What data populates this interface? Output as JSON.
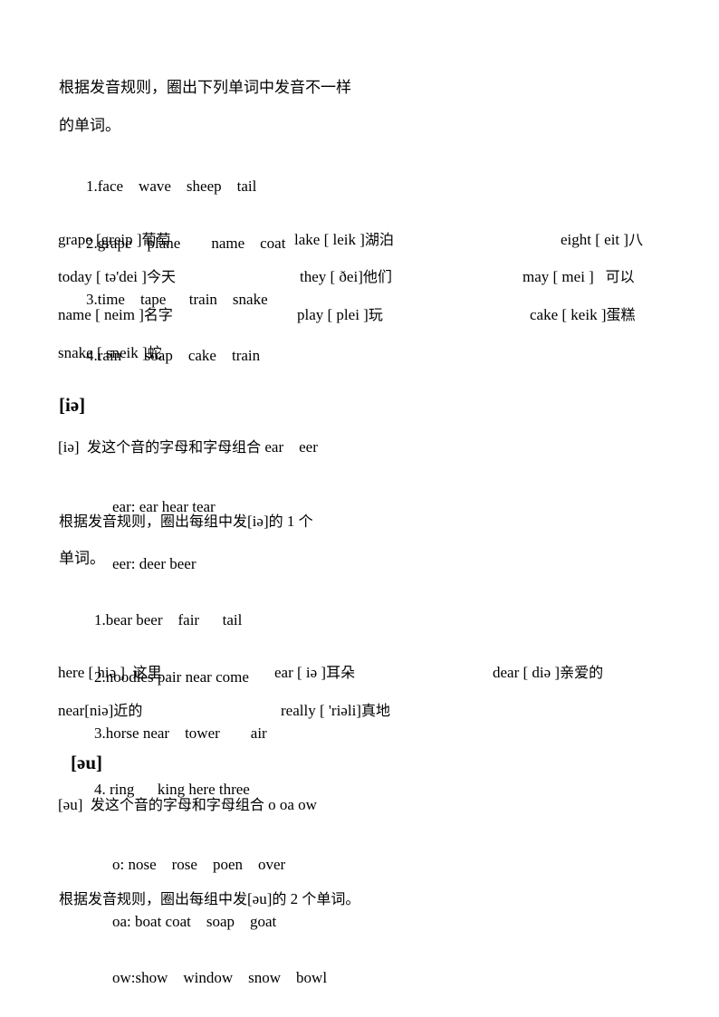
{
  "section1": {
    "instruction_line1": "根据发音规则，圈出下列单词中发音不一样",
    "instruction_line2": "的单词。",
    "exercises": [
      "1.face    wave    sheep    tail",
      "2.grape    plane        name    coat",
      "3.time    tape      train    snake",
      "4.rain      soap    cake    train"
    ],
    "vocab": [
      {
        "word": "grape [greip ]",
        "meaning": "葡萄"
      },
      {
        "word": "lake [ leik ]",
        "meaning": "湖泊"
      },
      {
        "word": "eight [ eit ]",
        "meaning": "八"
      },
      {
        "word": "today [ tə'dei ]",
        "meaning": "今天"
      },
      {
        "word": "they [ ðei]",
        "meaning": "他们"
      },
      {
        "word": "may [ mei ]   ",
        "meaning": "可以"
      },
      {
        "word": "name [ neim ]",
        "meaning": "名字"
      },
      {
        "word": "play [ plei ]",
        "meaning": "玩"
      },
      {
        "word": "cake [ keik ]",
        "meaning": "蛋糕"
      },
      {
        "word": "snake [ sneik ]",
        "meaning": "蛇"
      }
    ]
  },
  "section2": {
    "heading": "[iə]",
    "intro_symbol": "[iə]  ",
    "intro_cn": "发这个音的字母和字母组合",
    "intro_letters": " ear    eer",
    "rules": [
      "ear: ear hear tear",
      "eer: deer beer"
    ],
    "instruction_cn1": "根据发音规则，圈出每组中发",
    "instruction_sym": "[iə]",
    "instruction_cn2": "的",
    "instruction_num": " 1 ",
    "instruction_cn3": "个",
    "instruction_line2": "单词。",
    "exercises": [
      "1.bear beer    fair      tail",
      "2.noodles pair near come",
      "3.horse near    tower        air",
      "4. ring      king here three"
    ],
    "vocab": [
      {
        "word": "here [ hiə ]  ",
        "meaning": "这里"
      },
      {
        "word": "ear [ iə ]",
        "meaning": "耳朵"
      },
      {
        "word": "dear [ diə ]",
        "meaning": "亲爱的"
      },
      {
        "word": "near[niə]",
        "meaning": "近的"
      },
      {
        "word": "really [ 'riəli]",
        "meaning": "真地"
      }
    ]
  },
  "section3": {
    "heading": "[əu]",
    "intro_symbol": "[əu]  ",
    "intro_cn": "发这个音的字母和字母组合",
    "intro_letters": " o oa ow",
    "rules": [
      "o: nose    rose    poen    over",
      "oa: boat coat    soap    goat",
      "ow:show    window    snow    bowl"
    ],
    "instruction_cn1": "根据发音规则，圈出每组中发",
    "instruction_sym": "[əu]",
    "instruction_cn2": "的",
    "instruction_num": " 2 ",
    "instruction_cn3": "个单词。"
  }
}
